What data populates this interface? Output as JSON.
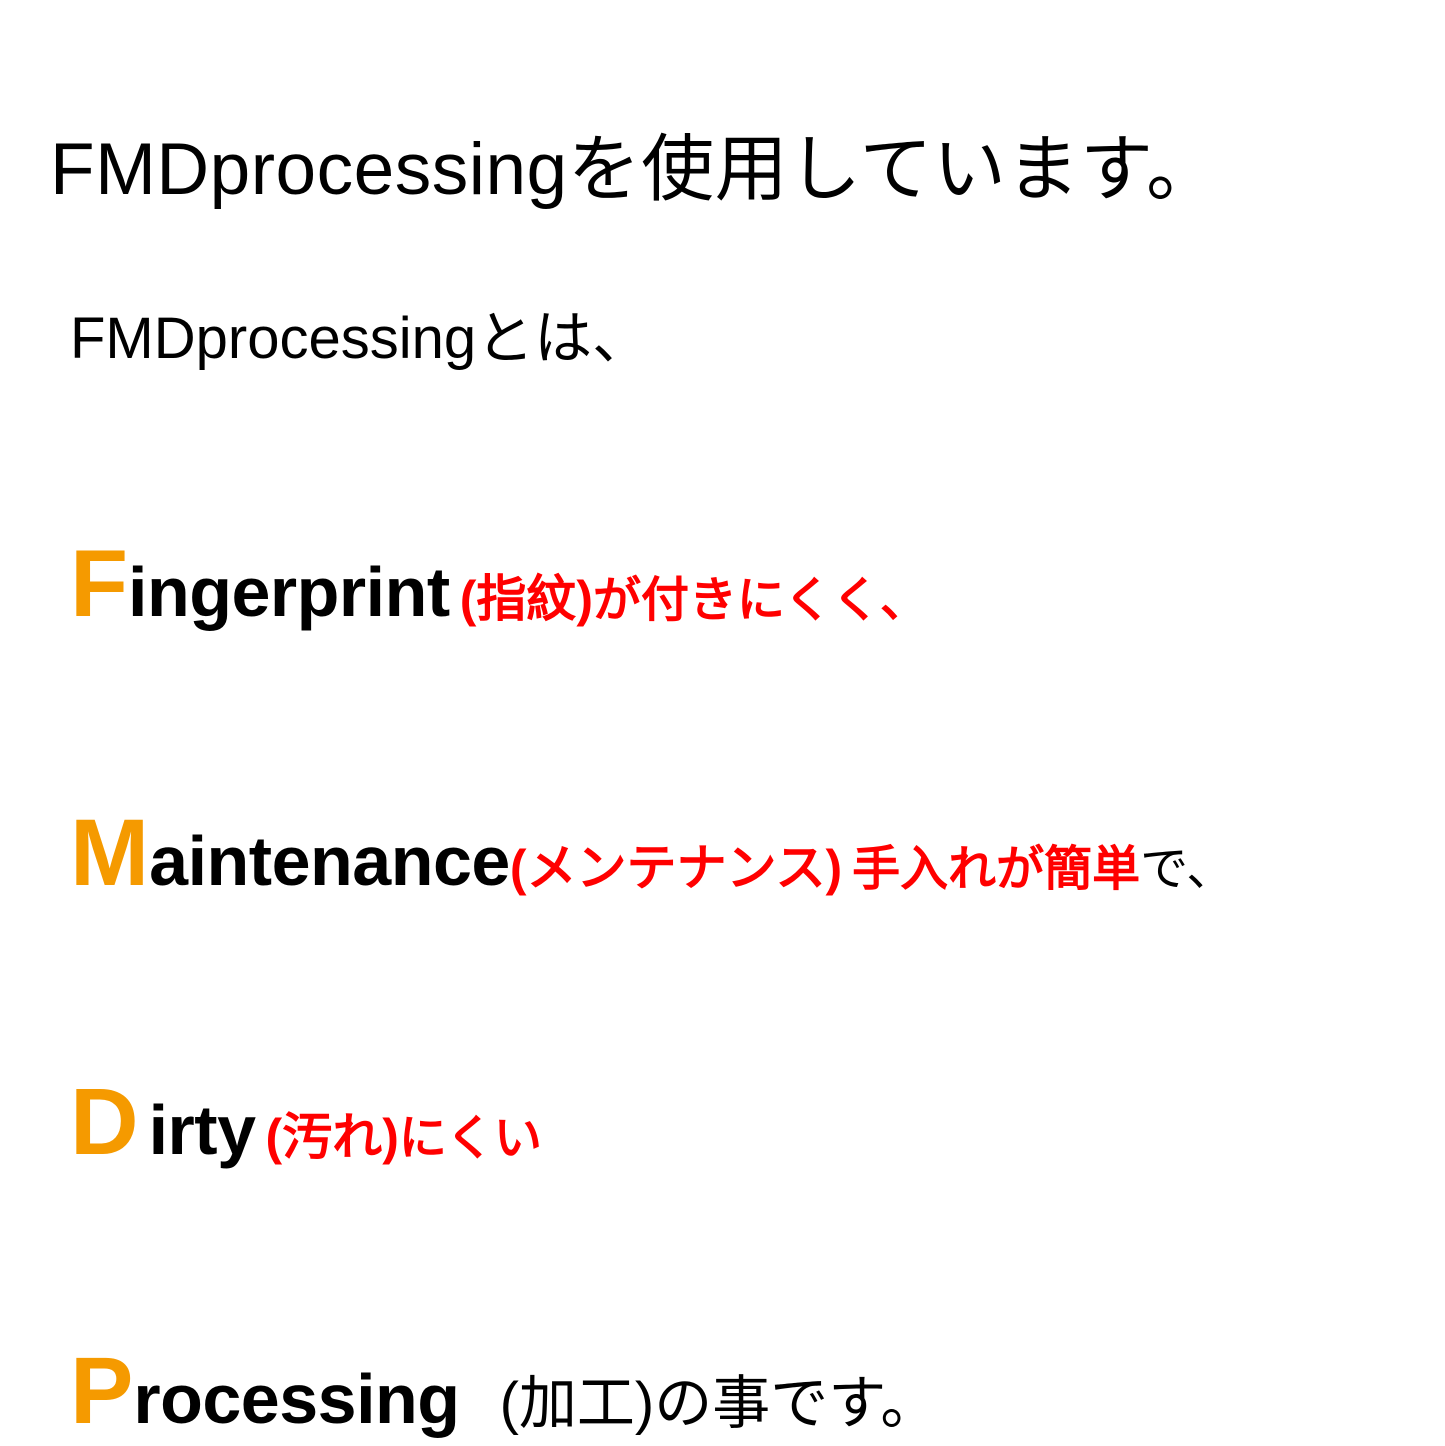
{
  "heading": "FMDprocessingを使用しています。",
  "subheading": "FMDprocessingとは、",
  "rows": {
    "f": {
      "initial": "F",
      "rest": "ingerprint",
      "paren": "(指紋)",
      "desc": "が付きにくく、"
    },
    "m": {
      "initial": "M",
      "rest": "aintenance",
      "paren": "(メンテナンス)",
      "desc": "手入れが簡単",
      "tail": "で、"
    },
    "d": {
      "initial": "D",
      "rest": "irty",
      "paren": "(汚れ)",
      "desc": "にくい"
    },
    "p": {
      "initial": "P",
      "rest": "rocessing",
      "paren": "(加工)",
      "tail": "の事です。"
    }
  }
}
